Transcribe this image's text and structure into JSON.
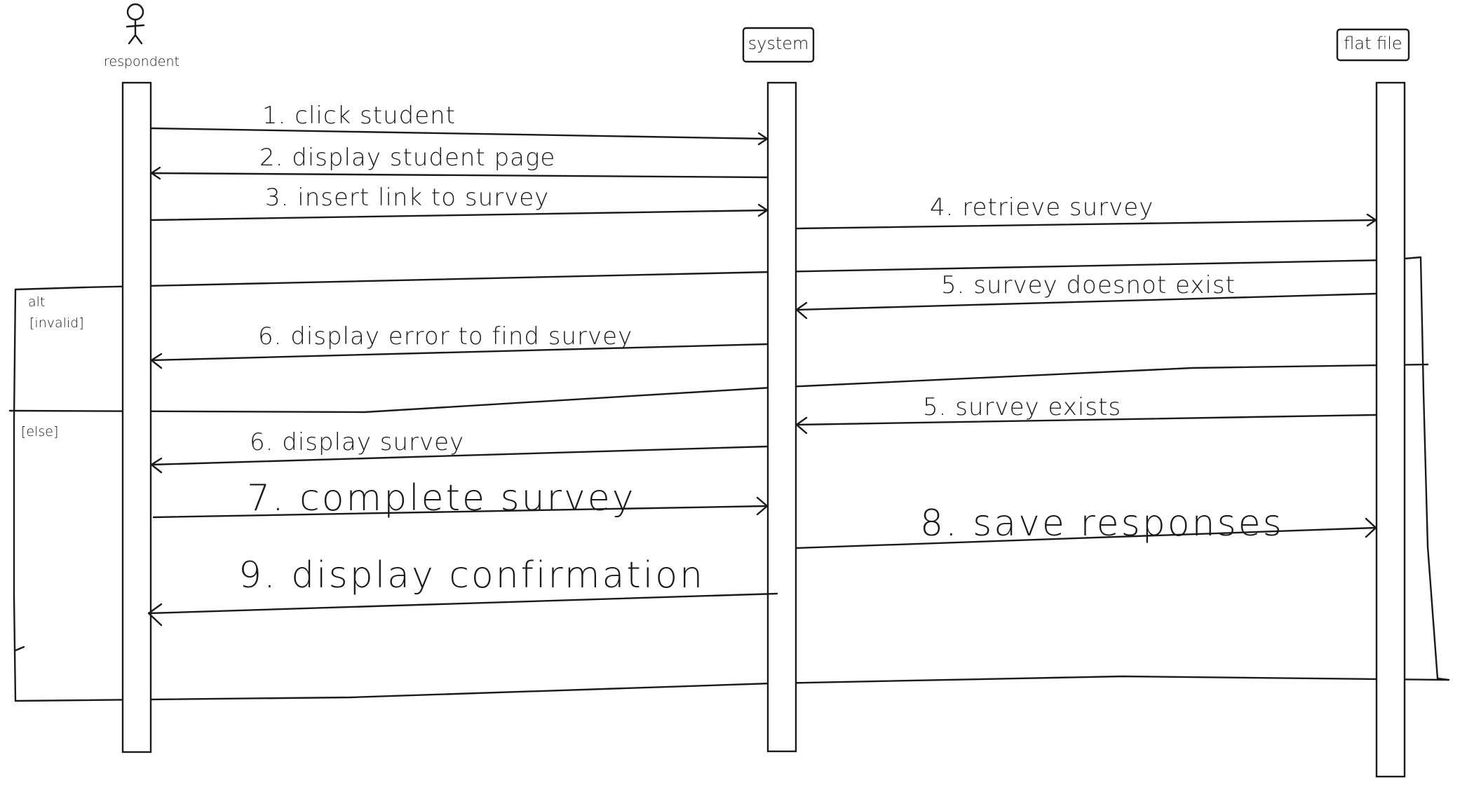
{
  "participants": {
    "respondent": "respondent",
    "system": "system",
    "flat_file": "flat file"
  },
  "alt_frame": {
    "operator": "alt",
    "guard_invalid": "[invalid]",
    "guard_else": "[else]"
  },
  "messages": {
    "m1": "1. click student",
    "m2": "2. display student page",
    "m3": "3. insert link to survey",
    "m4": "4. retrieve survey",
    "m5a": "5. survey doesnot exist",
    "m6a": "6. display error to find survey",
    "m5b": "5. survey exists",
    "m6b": "6. display survey",
    "m7": "7. complete survey",
    "m8": "8. save responses",
    "m9": "9. display confirmation"
  }
}
